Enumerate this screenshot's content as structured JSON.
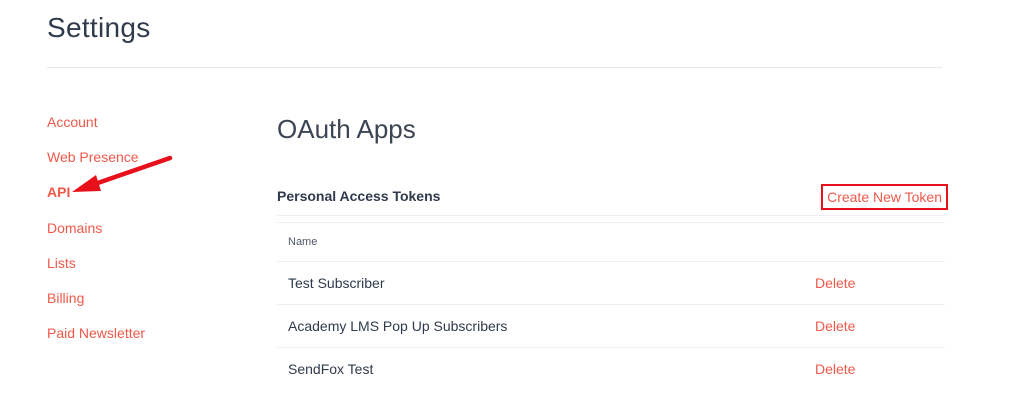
{
  "page": {
    "title": "Settings"
  },
  "sidebar": {
    "items": [
      {
        "label": "Account"
      },
      {
        "label": "Web Presence"
      },
      {
        "label": "API"
      },
      {
        "label": "Domains"
      },
      {
        "label": "Lists"
      },
      {
        "label": "Billing"
      },
      {
        "label": "Paid Newsletter"
      }
    ],
    "active_index": 2
  },
  "main": {
    "section_title": "OAuth Apps",
    "tokens": {
      "title": "Personal Access Tokens",
      "create_label": "Create New Token",
      "column_name": "Name",
      "rows": [
        {
          "name": "Test Subscriber",
          "action": "Delete"
        },
        {
          "name": "Academy LMS Pop Up Subscribers",
          "action": "Delete"
        },
        {
          "name": "SendFox Test",
          "action": "Delete"
        }
      ]
    }
  },
  "colors": {
    "accent": "#f0594a",
    "annotation_red": "#e8101a",
    "heading": "#2f3b4c",
    "divider": "#eceef1"
  }
}
